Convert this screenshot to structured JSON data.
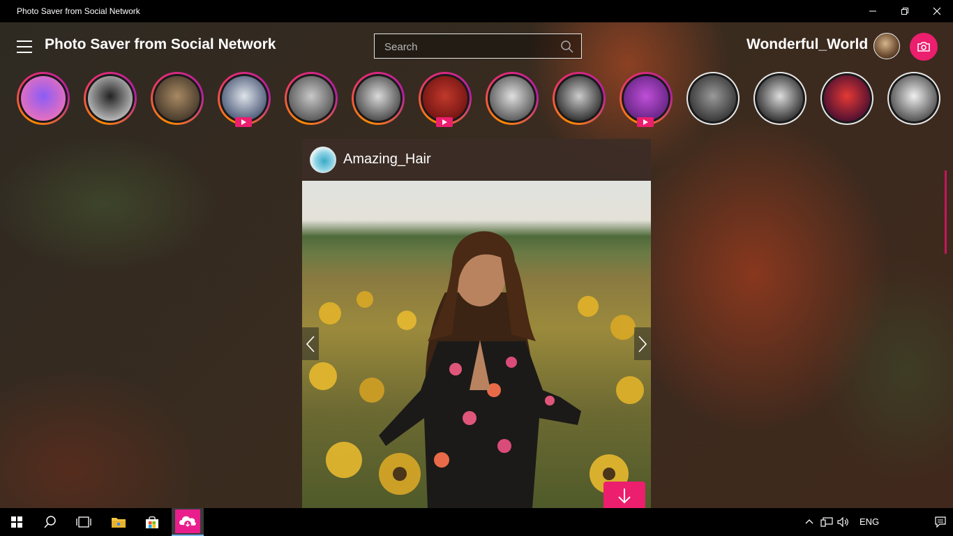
{
  "window": {
    "title": "Photo Saver from Social Network"
  },
  "header": {
    "app_title": "Photo Saver from Social Network",
    "search_placeholder": "Search",
    "username": "Wonderful_World"
  },
  "stories": [
    {
      "state": "active",
      "video": false,
      "colors": [
        "#8b5cf6",
        "#f472b6"
      ]
    },
    {
      "state": "active",
      "video": false,
      "colors": [
        "#222222",
        "#cfcfcf"
      ]
    },
    {
      "state": "active",
      "video": false,
      "colors": [
        "#a88a63",
        "#3b2f24"
      ]
    },
    {
      "state": "active",
      "video": true,
      "colors": [
        "#dfe4ea",
        "#3b4a6b"
      ]
    },
    {
      "state": "active",
      "video": false,
      "colors": [
        "#c9c9c9",
        "#4a4a4a"
      ]
    },
    {
      "state": "active",
      "video": false,
      "colors": [
        "#dadada",
        "#3a3a3a"
      ]
    },
    {
      "state": "active",
      "video": true,
      "colors": [
        "#c0392b",
        "#6b1010"
      ]
    },
    {
      "state": "active",
      "video": false,
      "colors": [
        "#e0e0e0",
        "#4a4a4a"
      ]
    },
    {
      "state": "active",
      "video": false,
      "colors": [
        "#cccccc",
        "#1e1e1e"
      ]
    },
    {
      "state": "active",
      "video": true,
      "colors": [
        "#c04fd8",
        "#5a1f7a"
      ]
    },
    {
      "state": "seen",
      "video": false,
      "colors": [
        "#9a9a9a",
        "#2a2a2a"
      ]
    },
    {
      "state": "seen",
      "video": false,
      "colors": [
        "#dddddd",
        "#1a1a1a"
      ]
    },
    {
      "state": "seen",
      "video": false,
      "colors": [
        "#e53935",
        "#3a0a30"
      ]
    },
    {
      "state": "seen",
      "video": false,
      "colors": [
        "#f0f0f0",
        "#3c3c3c"
      ]
    }
  ],
  "post": {
    "username": "Amazing_Hair"
  },
  "taskbar": {
    "language": "ENG"
  }
}
